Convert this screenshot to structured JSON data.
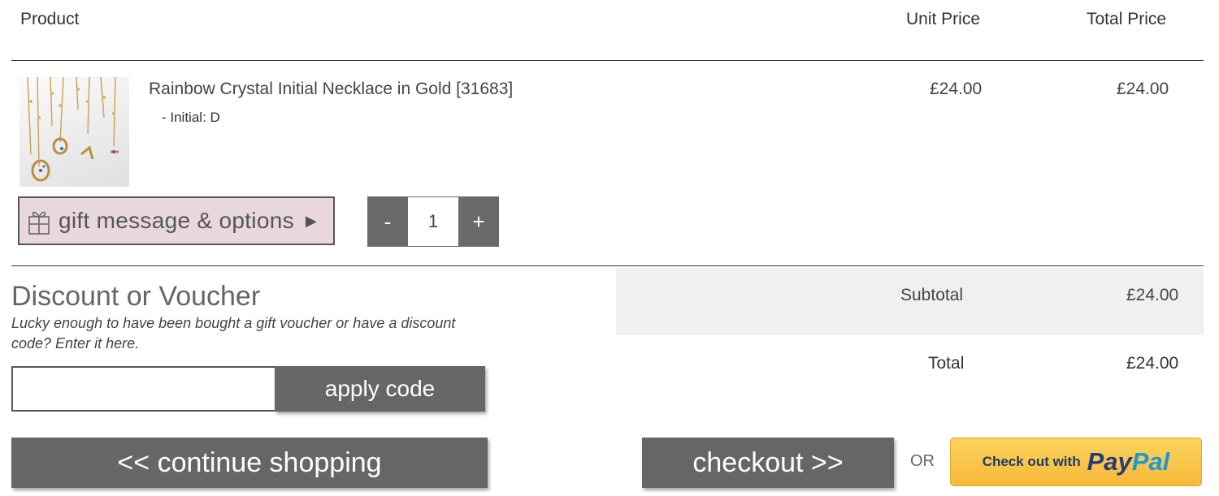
{
  "header": {
    "product_label": "Product",
    "unit_price_label": "Unit Price",
    "total_price_label": "Total Price"
  },
  "item": {
    "name": "Rainbow Crystal Initial Necklace in Gold [31683]",
    "option": "-  Initial: D",
    "unit_price": "£24.00",
    "total_price": "£24.00",
    "image_icon": "necklace-product-photo",
    "gift_button_label": "gift message & options",
    "gift_arrow": "▶",
    "quantity": "1",
    "qty_minus": "-",
    "qty_plus": "+"
  },
  "discount": {
    "title": "Discount or Voucher",
    "description": "Lucky enough to have been bought a gift voucher or have a discount code? Enter it here.",
    "input_value": "",
    "input_placeholder": "",
    "apply_label": "apply code"
  },
  "totals": {
    "subtotal_label": "Subtotal",
    "subtotal_value": "£24.00",
    "total_label": "Total",
    "total_value": "£24.00"
  },
  "actions": {
    "continue_label": "<< continue shopping",
    "checkout_label": "checkout >>",
    "or_label": "OR",
    "paypal_prefix": "Check out with",
    "paypal_pay": "Pay",
    "paypal_pal": "Pal"
  },
  "colors": {
    "button_bg": "#666666",
    "gift_bg": "#e8d7df",
    "paypal_bg": "#f6b93a",
    "subtotal_bg": "#f0f0f0"
  }
}
